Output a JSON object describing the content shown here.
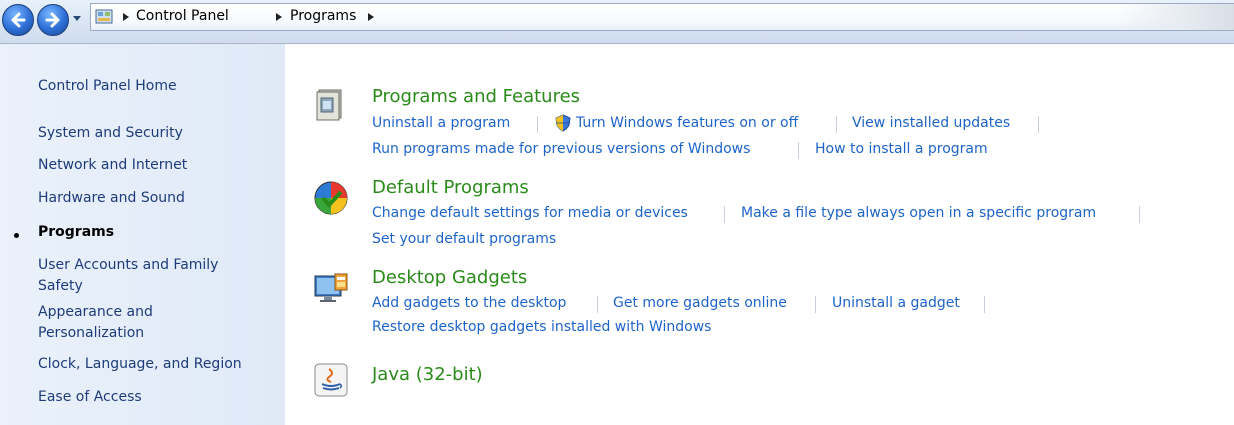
{
  "nav": {
    "back_icon": "back-arrow-icon",
    "forward_icon": "forward-arrow-icon",
    "breadcrumb": [
      "Control Panel",
      "Programs"
    ]
  },
  "sidebar": {
    "items": [
      {
        "label": "Control Panel Home"
      },
      {
        "label": "System and Security"
      },
      {
        "label": "Network and Internet"
      },
      {
        "label": "Hardware and Sound"
      },
      {
        "label": "Programs",
        "current": true
      },
      {
        "label": "User Accounts and Family Safety"
      },
      {
        "label": "Appearance and Personalization"
      },
      {
        "label": "Clock, Language, and Region"
      },
      {
        "label": "Ease of Access"
      }
    ]
  },
  "categories": [
    {
      "title": "Programs and Features",
      "icon": "programs-features-icon",
      "tasks": [
        "Uninstall a program",
        "Turn Windows features on or off",
        "View installed updates",
        "Run programs made for previous versions of Windows",
        "How to install a program"
      ]
    },
    {
      "title": "Default Programs",
      "icon": "default-programs-icon",
      "tasks": [
        "Change default settings for media or devices",
        "Make a file type always open in a specific program",
        "Set your default programs"
      ]
    },
    {
      "title": "Desktop Gadgets",
      "icon": "desktop-gadgets-icon",
      "tasks": [
        "Add gadgets to the desktop",
        "Get more gadgets online",
        "Uninstall a gadget",
        "Restore desktop gadgets installed with Windows"
      ]
    },
    {
      "title": "Java (32-bit)",
      "icon": "java-icon",
      "tasks": []
    }
  ],
  "colors": {
    "category_title": "#2a8a1a",
    "task_link": "#1e64c8",
    "sidebar_bg": "#e5edf9"
  }
}
